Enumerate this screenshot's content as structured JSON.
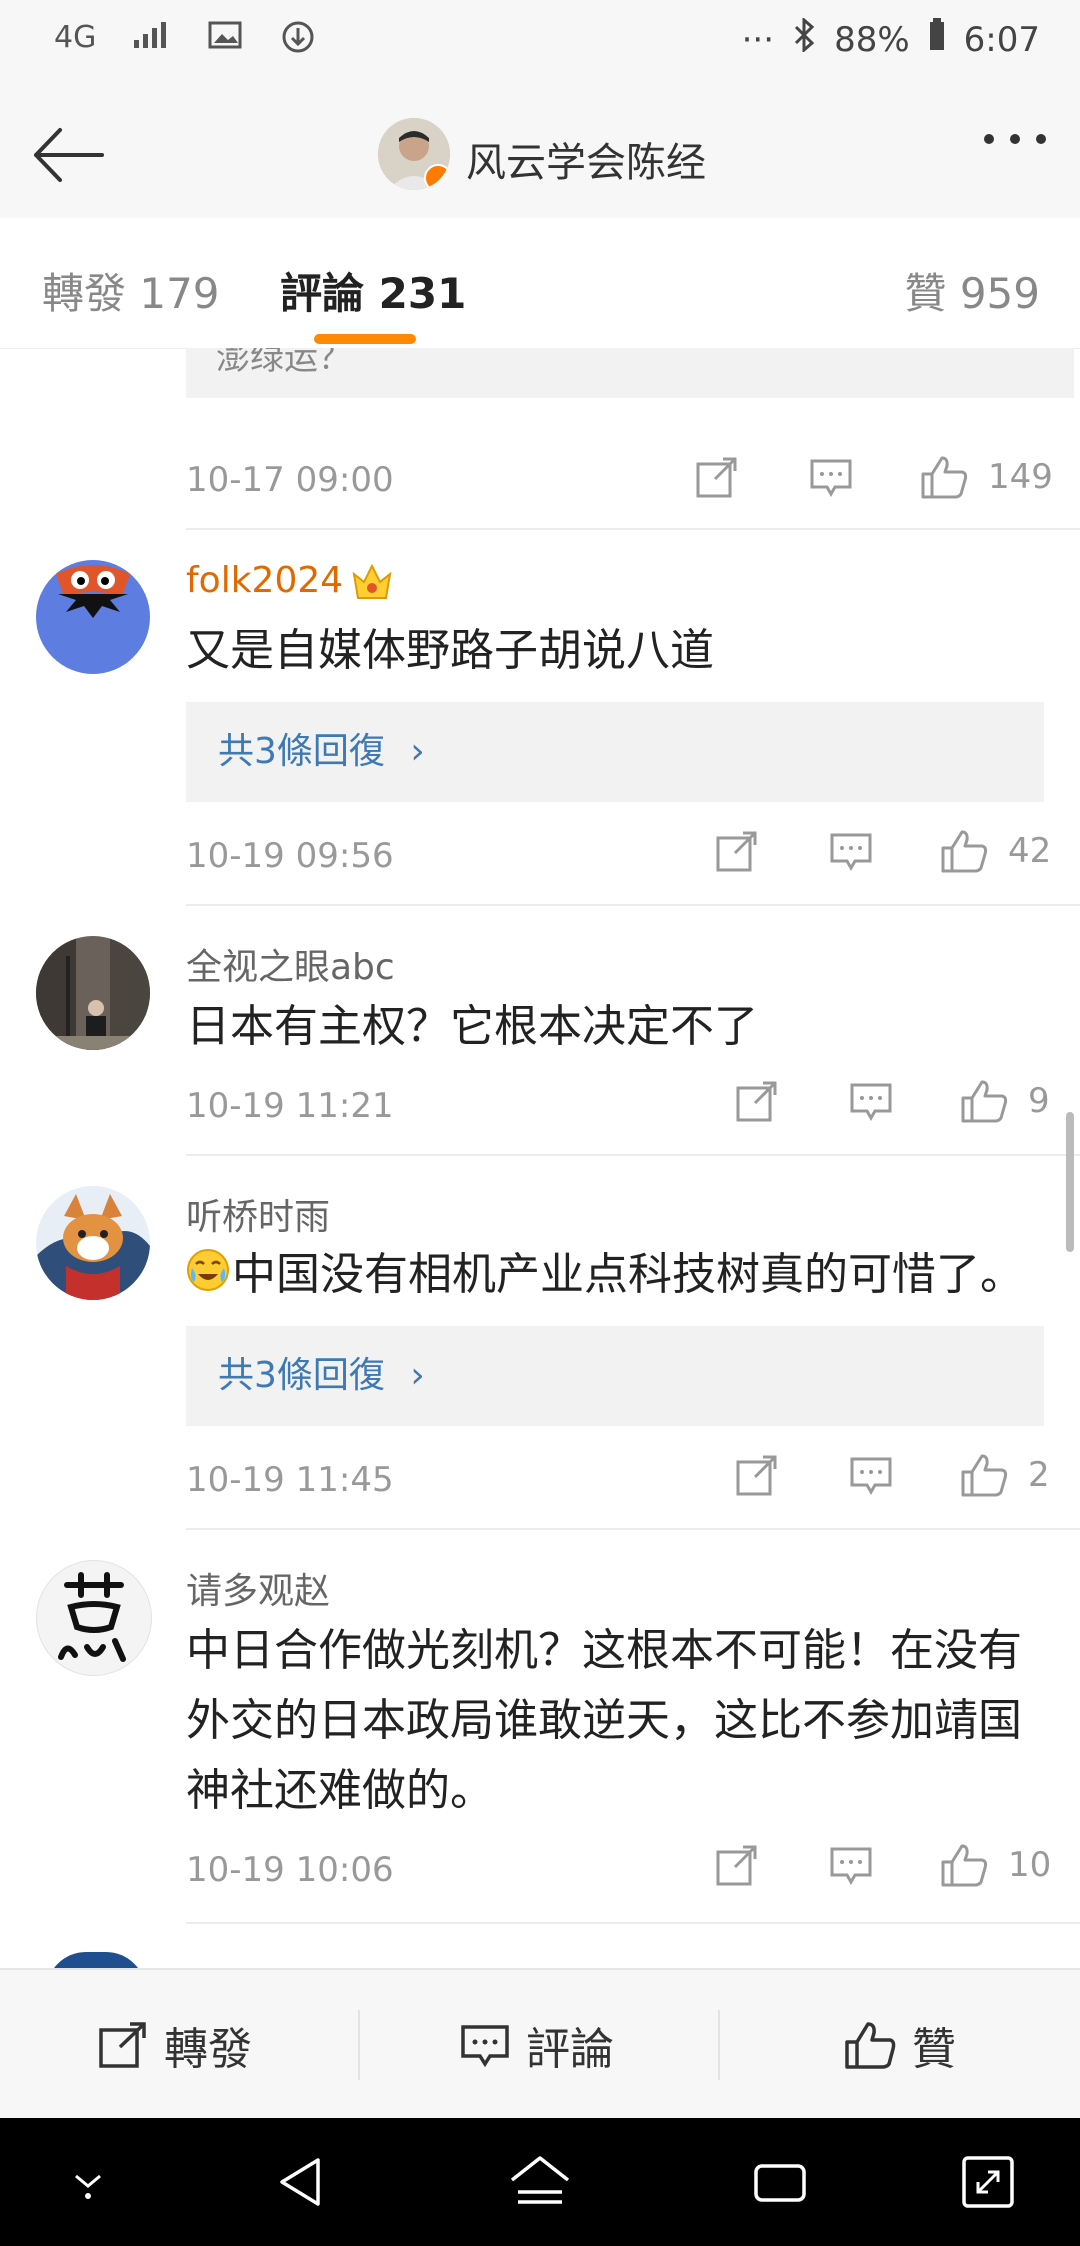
{
  "status_bar": {
    "network": "4G",
    "battery": "88%",
    "time": "6:07",
    "more": "···"
  },
  "header": {
    "title": "风云学会陈经",
    "verified_badge": "v"
  },
  "tabs": [
    {
      "label": "轉發 179"
    },
    {
      "label": "評論 231"
    },
    {
      "label": "贊 959"
    }
  ],
  "top_item": {
    "quote_remnant": "澎绿运？",
    "time": "10-17 09:00",
    "likes": "149"
  },
  "comments": [
    {
      "user": "folk2024",
      "text": "又是自媒体野路子胡说八道",
      "replies": "共3條回復",
      "time": "10-19 09:56",
      "likes": "42"
    },
    {
      "user": "全视之眼abc",
      "text": "日本有主权？它根本决定不了",
      "time": "10-19 11:21",
      "likes": "9"
    },
    {
      "user": "听桥时雨",
      "text": "中国没有相机产业点科技树真的可惜了。",
      "replies": "共3條回復",
      "time": "10-19 11:45",
      "likes": "2"
    },
    {
      "user": "请多观赵",
      "text_lines": [
        "中日合作做光刻机？这根本不可能！在没有",
        "外交的日本政局谁敢逆天，这比不参加靖国",
        "神社还难做的。"
      ],
      "time": "10-19 10:06",
      "likes": "10"
    }
  ],
  "bottom_bar": {
    "repost": "轉發",
    "comment": "評論",
    "like": "贊"
  },
  "colors": {
    "accent_orange": "#ff8a00",
    "link_blue": "#3d79b3",
    "vip_name": "#e06a00"
  }
}
